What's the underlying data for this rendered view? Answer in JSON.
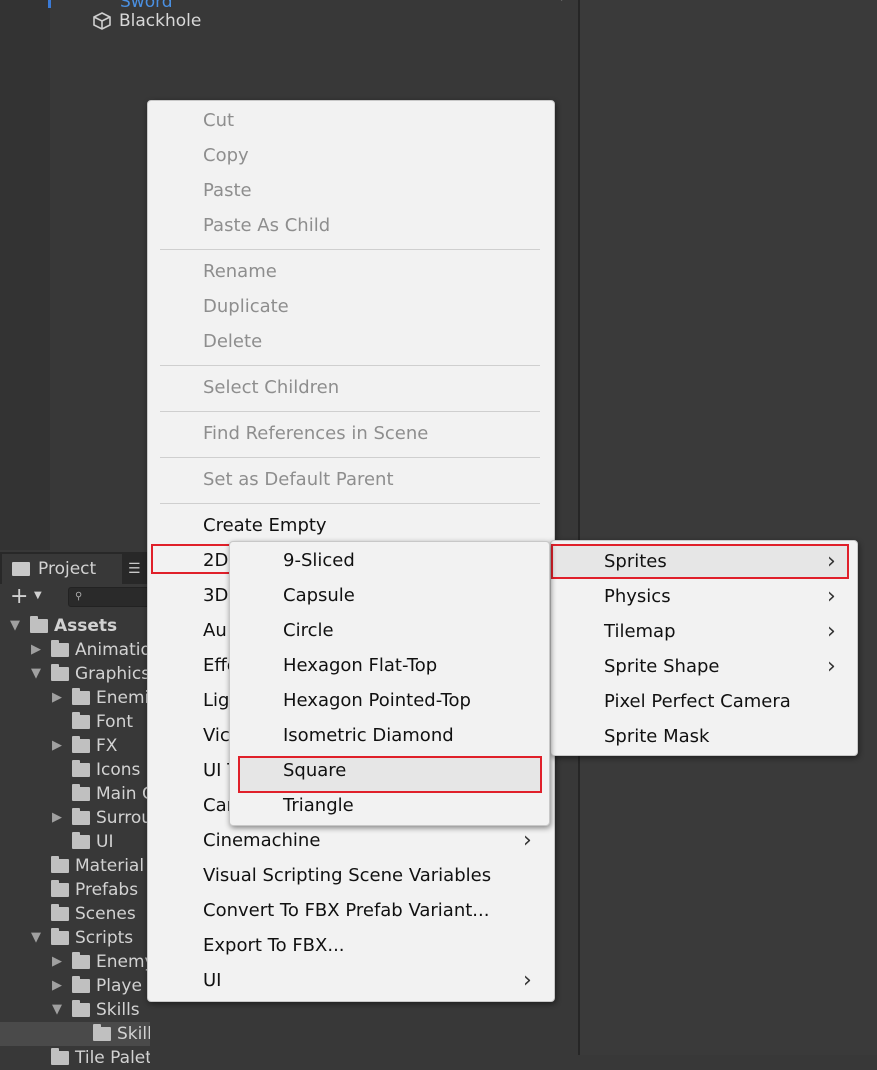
{
  "hierarchy": {
    "items": [
      {
        "label": "Sword"
      },
      {
        "label": "Blackhole"
      }
    ]
  },
  "project": {
    "tab_label": "Project",
    "tab_menu_icon": "list-icon",
    "add_button_icon": "plus-icon",
    "search_icon": "search-icon",
    "tree": [
      {
        "label": "Assets",
        "depth": 0,
        "expanded": true,
        "bold": true
      },
      {
        "label": "Animatio",
        "depth": 1,
        "expanded": false
      },
      {
        "label": "Graphics",
        "depth": 1,
        "expanded": true
      },
      {
        "label": "Enemi",
        "depth": 2,
        "expanded": false
      },
      {
        "label": "Font",
        "depth": 2,
        "leaf": true
      },
      {
        "label": "FX",
        "depth": 2,
        "expanded": false
      },
      {
        "label": "Icons",
        "depth": 2,
        "leaf": true
      },
      {
        "label": "Main C",
        "depth": 2,
        "leaf": true
      },
      {
        "label": "Surrou",
        "depth": 2,
        "expanded": false
      },
      {
        "label": "UI",
        "depth": 2,
        "leaf": true
      },
      {
        "label": "Material",
        "depth": 1,
        "leaf": true
      },
      {
        "label": "Prefabs",
        "depth": 1,
        "leaf": true
      },
      {
        "label": "Scenes",
        "depth": 1,
        "leaf": true
      },
      {
        "label": "Scripts",
        "depth": 1,
        "expanded": true
      },
      {
        "label": "Enemy",
        "depth": 2,
        "expanded": false
      },
      {
        "label": "Playe",
        "depth": 2,
        "expanded": false
      },
      {
        "label": "Skills",
        "depth": 2,
        "expanded": true
      },
      {
        "label": "Skill",
        "depth": 3,
        "leaf": true,
        "selected": true
      },
      {
        "label": "Tile Palet",
        "depth": 1,
        "leaf": true
      }
    ]
  },
  "context_menu": {
    "items": [
      {
        "label": "Cut",
        "enabled": false
      },
      {
        "label": "Copy",
        "enabled": false
      },
      {
        "label": "Paste",
        "enabled": false
      },
      {
        "label": "Paste As Child",
        "enabled": false
      },
      {
        "label": "Rename",
        "enabled": false
      },
      {
        "label": "Duplicate",
        "enabled": false
      },
      {
        "label": "Delete",
        "enabled": false
      },
      {
        "label": "Select Children",
        "enabled": false
      },
      {
        "label": "Find References in Scene",
        "enabled": false
      },
      {
        "label": "Set as Default Parent",
        "enabled": false
      },
      {
        "label": "Create Empty",
        "enabled": true
      },
      {
        "label": "2D",
        "enabled": true,
        "submenu": true,
        "highlighted": true
      },
      {
        "label": "3D",
        "enabled": true,
        "submenu": true
      },
      {
        "label": "Au",
        "enabled": true,
        "submenu": true
      },
      {
        "label": "Effe",
        "enabled": true,
        "submenu": true
      },
      {
        "label": "Lig",
        "enabled": true,
        "submenu": true
      },
      {
        "label": "Vic",
        "enabled": true,
        "submenu": true
      },
      {
        "label": "UI T",
        "enabled": true,
        "submenu": true
      },
      {
        "label": "Car",
        "enabled": true,
        "submenu": true
      },
      {
        "label": "Cinemachine",
        "enabled": true,
        "submenu": true
      },
      {
        "label": "Visual Scripting Scene Variables",
        "enabled": true
      },
      {
        "label": "Convert To FBX Prefab Variant...",
        "enabled": true
      },
      {
        "label": "Export To FBX...",
        "enabled": true
      },
      {
        "label": "UI",
        "enabled": true,
        "submenu": true
      }
    ]
  },
  "submenu_2d": {
    "items": [
      {
        "label": "Sprites",
        "submenu": true,
        "highlighted": true
      },
      {
        "label": "Physics",
        "submenu": true
      },
      {
        "label": "Tilemap",
        "submenu": true
      },
      {
        "label": "Sprite Shape",
        "submenu": true
      },
      {
        "label": "Pixel Perfect Camera"
      },
      {
        "label": "Sprite Mask"
      }
    ]
  },
  "submenu_sprites": {
    "items": [
      {
        "label": "9-Sliced"
      },
      {
        "label": "Capsule"
      },
      {
        "label": "Circle"
      },
      {
        "label": "Hexagon Flat-Top"
      },
      {
        "label": "Hexagon Pointed-Top"
      },
      {
        "label": "Isometric Diamond"
      },
      {
        "label": "Square",
        "highlighted": true
      },
      {
        "label": "Triangle"
      }
    ]
  },
  "colors": {
    "highlight_border": "#e0202a",
    "menu_bg": "#f2f2f2",
    "editor_bg": "#383838"
  }
}
